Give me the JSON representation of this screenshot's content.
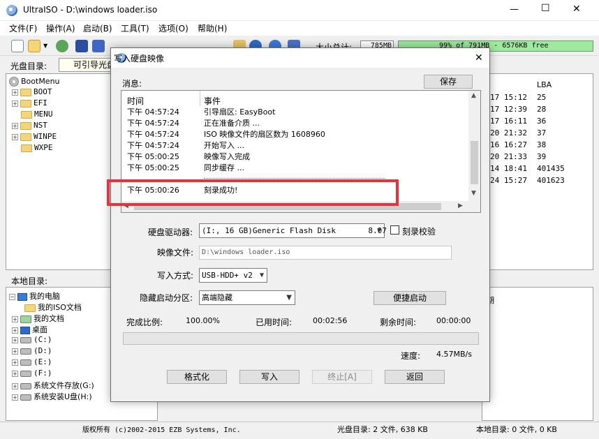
{
  "window": {
    "title": "UltraISO - D:\\windows loader.iso",
    "controls": {
      "minimize": "—",
      "maximize": "☐",
      "close": "✕"
    }
  },
  "menu": [
    "文件(F)",
    "操作(A)",
    "启动(B)",
    "工具(T)",
    "选项(O)",
    "帮助(H)"
  ],
  "toolbar": {
    "size_total_label": "大小总计:",
    "size_total_value": "785MB",
    "capacity_text": "99% of 791MB - 6576KB free"
  },
  "cd_bar": {
    "label": "光盘目录:",
    "value": "可引导光盘"
  },
  "cd_tree": {
    "root": "BootMenu",
    "items": [
      "BOOT",
      "EFI",
      "MENU",
      "NST",
      "WINPE",
      "WXPE"
    ]
  },
  "right_list": {
    "header": "LBA",
    "rows": [
      {
        "time": "17 15:12",
        "lba": "25"
      },
      {
        "time": "17 12:39",
        "lba": "28"
      },
      {
        "time": "17 16:11",
        "lba": "36"
      },
      {
        "time": "20 21:32",
        "lba": "37"
      },
      {
        "time": "16 16:27",
        "lba": "38"
      },
      {
        "time": "20 21:33",
        "lba": "39"
      },
      {
        "time": "14 18:41",
        "lba": "401435"
      },
      {
        "time": "24 15:27",
        "lba": "401623"
      }
    ],
    "lower_header": "期"
  },
  "local_bar": {
    "label": "本地目录:"
  },
  "local_tree": {
    "root": "我的电脑",
    "items": [
      "我的ISO文档",
      "我的文档",
      "桌面",
      "(C:)",
      "(D:)",
      "(E:)",
      "(F:)",
      "系统文件存放(G:)",
      "系统安装U盘(H:)"
    ]
  },
  "dialog": {
    "title": "写入硬盘映像",
    "close": "✕",
    "message_label": "消息:",
    "save_button": "保存",
    "log_headers": {
      "time": "时间",
      "event": "事件"
    },
    "log": [
      {
        "time": "下午 04:57:24",
        "event": "引导扇区: EasyBoot"
      },
      {
        "time": "下午 04:57:24",
        "event": "正在准备介质 ..."
      },
      {
        "time": "下午 04:57:24",
        "event": "ISO 映像文件的扇区数为 1608960"
      },
      {
        "time": "下午 04:57:24",
        "event": "开始写入 ..."
      },
      {
        "time": "下午 05:00:25",
        "event": "映像写入完成"
      },
      {
        "time": "下午 05:00:25",
        "event": "同步缓存 ..."
      },
      {
        "time": "下午 05:00:26",
        "event": "刻录成功!"
      }
    ],
    "drive_label": "硬盘驱动器:",
    "drive_value": "(I:, 16 GB)Generic Flash Disk       8.07",
    "verify_label": "刻录校验",
    "image_label": "映像文件:",
    "image_value": "D:\\windows loader.iso",
    "write_mode_label": "写入方式:",
    "write_mode_value": "USB-HDD+ v2",
    "hide_label": "隐藏启动分区:",
    "hide_value": "高端隐藏",
    "quick_boot_button": "便捷启动",
    "progress_label": "完成比例:",
    "progress_value": "100.00%",
    "progress_fraction": 1.0,
    "elapsed_label": "已用时间:",
    "elapsed_value": "00:02:56",
    "remain_label": "剩余时间:",
    "remain_value": "00:00:00",
    "speed_label": "速度:",
    "speed_value": "4.57MB/s",
    "buttons": {
      "format": "格式化",
      "write": "写入",
      "stop": "终止[A]",
      "back": "返回"
    }
  },
  "status": {
    "copyright": "版权所有 (c)2002-2015 EZB Systems, Inc.",
    "cd_info": "光盘目录: 2 文件, 638 KB",
    "local_info": "本地目录: 0 文件, 0 KB"
  },
  "colors": {
    "highlight_box": "#e8323c",
    "accent": "#0078d7"
  }
}
